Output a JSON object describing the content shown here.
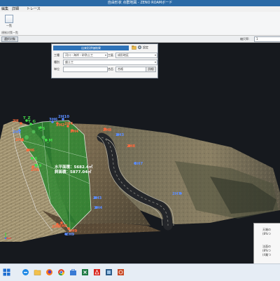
{
  "window": {
    "title": "自由形状 点群地図 - ZENO ROAMボード"
  },
  "menu": [
    {
      "label": "編集"
    },
    {
      "label": "詳細"
    },
    {
      "label": "トレース"
    }
  ],
  "ribbon": {
    "button_label": "一覧",
    "group_label": "規制対策一覧"
  },
  "toolbar": {
    "command_label": "選択対象",
    "scale_label": "縮尺率:",
    "scale_value": "1"
  },
  "panel": {
    "header": "出来形評価結果",
    "tool_label": "設定",
    "work_type_label": "工種",
    "work_type_value": "河川・海岸・砂防土工",
    "work_label": "工區",
    "work_value": "成形地区",
    "category_label": "種別",
    "category_value": "盛土工",
    "unit_label": "単位",
    "judgment_label": "合否",
    "judgment_value": "合格",
    "detail_button": "詳細"
  },
  "markers": [
    {
      "label": "2H",
      "color": "#ff6a3d"
    },
    {
      "label": "T_Z",
      "color": "#44e04a"
    },
    {
      "label": "T_G",
      "color": "#44e04a"
    },
    {
      "label": "3H6",
      "color": "#5b8cff"
    },
    {
      "label": "2H2",
      "color": "#ff6a3d"
    },
    {
      "label": "2H10",
      "color": "#5b8cff"
    },
    {
      "label": "2H4",
      "color": "#ff6a3d"
    },
    {
      "label": "2H4",
      "color": "#ff6a3d"
    },
    {
      "label": "2H8",
      "color": "#ff6a3d"
    },
    {
      "label": "2H8",
      "color": "#ff6a3d"
    },
    {
      "label": "2H1",
      "color": "#5b8cff"
    },
    {
      "label": "2H5",
      "color": "#ff6a3d"
    },
    {
      "label": "2H3",
      "color": "#5b8cff"
    },
    {
      "label": "2H6",
      "color": "#ff6a3d"
    },
    {
      "label": "3H7",
      "color": "#5b8cff"
    },
    {
      "label": "T_S",
      "color": "#44e04a"
    },
    {
      "label": "T_M",
      "color": "#44e04a"
    },
    {
      "label": "T_6",
      "color": "#44e04a"
    },
    {
      "label": "T_9",
      "color": "#44e04a"
    },
    {
      "label": "2H7",
      "color": "#5b8cff"
    },
    {
      "label": "2H5",
      "color": "#ff6a3d"
    },
    {
      "label": "2H3",
      "color": "#5b8cff"
    },
    {
      "label": "1H4",
      "color": "#5b8cff"
    },
    {
      "label": "2H6",
      "color": "#ff6a3d"
    },
    {
      "label": "2H9",
      "color": "#5b8cff"
    },
    {
      "label": "2H9",
      "color": "#ff6a3d"
    },
    {
      "label": "2H6",
      "color": "#ff6a3d"
    }
  ],
  "area_info": {
    "line1": "水平面積：5682.4㎡",
    "line2": "斜面積：5877.04㎡"
  },
  "info_right": [
    "天端の",
    "(8%つ",
    "法面の",
    "(8%つ",
    "(4業つ"
  ],
  "taskbar": {
    "icons": [
      "windows-icon",
      "edge-icon",
      "explorer-icon",
      "firefox-icon",
      "chrome-icon",
      "store-icon",
      "excel-icon",
      "acrobat-icon",
      "app-icon",
      "powerpoint-icon"
    ]
  }
}
